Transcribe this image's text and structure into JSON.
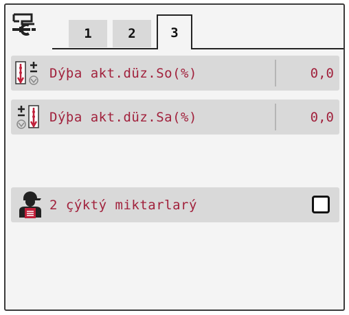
{
  "tabs": [
    {
      "label": "1",
      "active": false
    },
    {
      "label": "2",
      "active": false
    },
    {
      "label": "3",
      "active": true
    }
  ],
  "icons": {
    "header": "settings-icon",
    "row1": "boundary-left-icon",
    "row2": "boundary-right-icon",
    "row3": "operator-document-icon"
  },
  "rows": [
    {
      "label": "Dýþa akt.düz.So(%)",
      "value": "0,0"
    },
    {
      "label": "Dýþa akt.düz.Sa(%)",
      "value": "0,0"
    }
  ],
  "toggle": {
    "label": "2 çýktý miktarlarý",
    "checked": false
  },
  "colors": {
    "text": "#a1213c",
    "row_bg": "#d9d9d9",
    "screen_bg": "#f4f4f4"
  }
}
